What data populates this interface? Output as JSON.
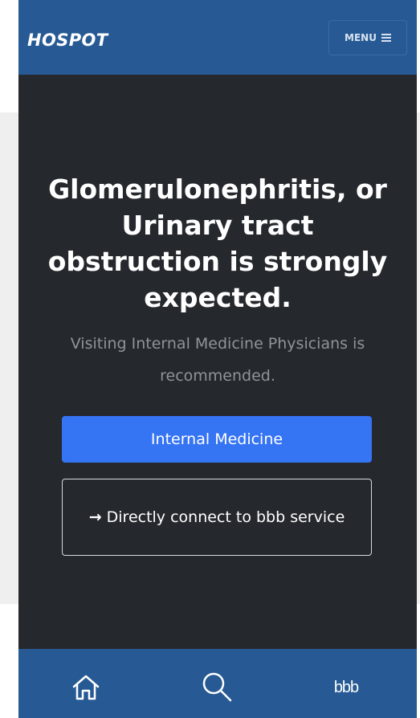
{
  "header": {
    "brand": "HOSPOT",
    "menu_label": "MENU"
  },
  "main": {
    "headline": "Glomerulonephritis, or Urinary tract obstruction is strongly expected.",
    "subtext": "Visiting Internal Medicine Physicians is recommended.",
    "primary_button": "Internal Medicine",
    "connect_button": "Directly connect to bbb service"
  },
  "bottom_nav": {
    "home_icon": "home-icon",
    "search_icon": "search-icon",
    "bbb_label": "bbb"
  },
  "colors": {
    "navbar": "#275a94",
    "background": "#25282d",
    "primary": "#3574f3"
  }
}
